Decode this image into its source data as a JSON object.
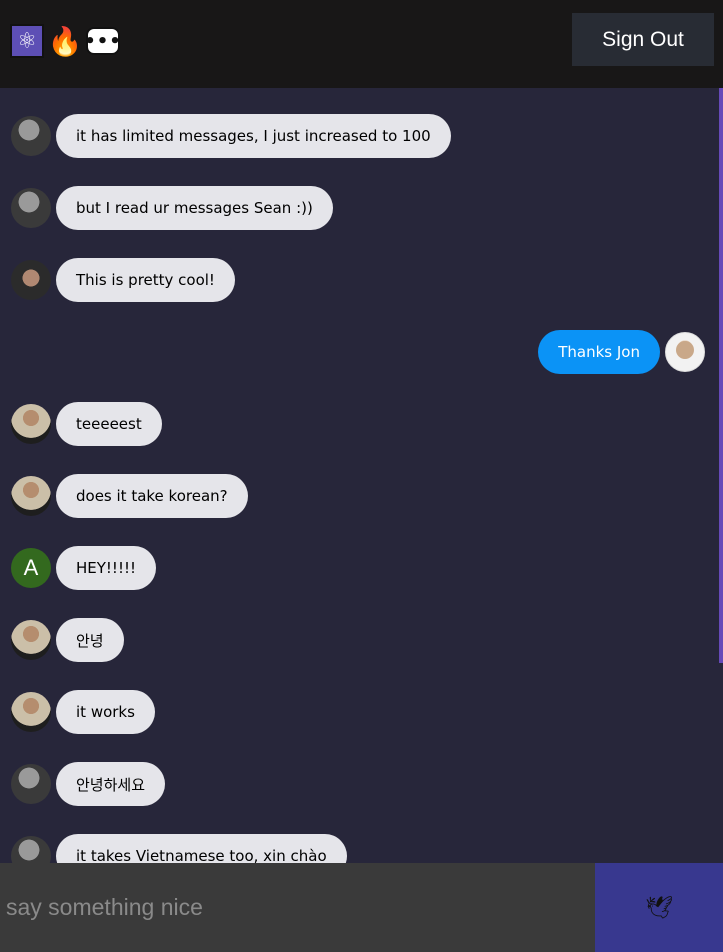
{
  "header": {
    "logos": [
      {
        "icon": "react-atom-icon",
        "glyph": "⚛"
      },
      {
        "icon": "fire-icon",
        "glyph": "🔥"
      },
      {
        "icon": "speech-bubble-icon",
        "glyph": "•••"
      }
    ],
    "signout_label": "Sign Out"
  },
  "messages": [
    {
      "text": "it has limited messages, I just increased to 100",
      "type": "received",
      "avatar": "photo-dark"
    },
    {
      "text": "but I read ur messages Sean :))",
      "type": "received",
      "avatar": "photo-dark"
    },
    {
      "text": "This is pretty cool!",
      "type": "received",
      "avatar": "beard"
    },
    {
      "text": "Thanks Jon",
      "type": "sent",
      "avatar": "glasses"
    },
    {
      "text": "teeeeest",
      "type": "received",
      "avatar": "man"
    },
    {
      "text": "does it take korean?",
      "type": "received",
      "avatar": "man"
    },
    {
      "text": "HEY!!!!!",
      "type": "received",
      "avatar": "letter",
      "avatar_letter": "A"
    },
    {
      "text": "안녕",
      "type": "received",
      "avatar": "man"
    },
    {
      "text": "it works",
      "type": "received",
      "avatar": "man"
    },
    {
      "text": "안녕하세요",
      "type": "received",
      "avatar": "photo-dark"
    },
    {
      "text": "it takes Vietnamese too, xin chào",
      "type": "received",
      "avatar": "photo-dark"
    }
  ],
  "composer": {
    "placeholder": "say something nice",
    "send_icon": "dove-icon",
    "send_glyph": "🕊"
  },
  "colors": {
    "header_bg": "#181717",
    "chat_bg": "#27263a",
    "received_bubble": "#e5e5ea",
    "sent_bubble": "#0b93f6",
    "send_button": "#38388f",
    "scrollbar": "#6649b8"
  }
}
